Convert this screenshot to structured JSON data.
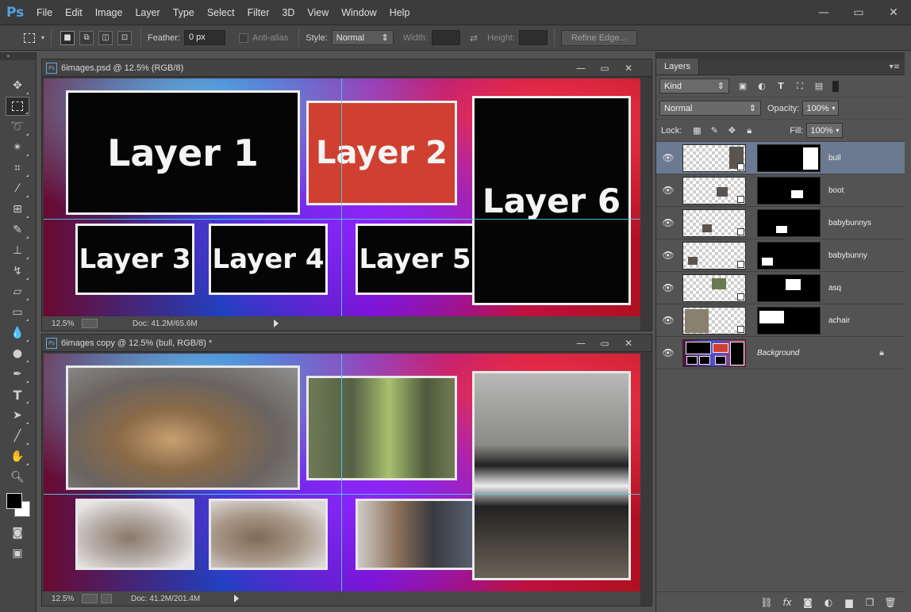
{
  "app": {
    "logo": "Ps",
    "menu": [
      "File",
      "Edit",
      "Image",
      "Layer",
      "Type",
      "Select",
      "Filter",
      "3D",
      "View",
      "Window",
      "Help"
    ]
  },
  "options": {
    "feather_label": "Feather:",
    "feather_value": "0 px",
    "antialias_label": "Anti-alias",
    "style_label": "Style:",
    "style_value": "Normal",
    "width_label": "Width:",
    "height_label": "Height:",
    "refine_label": "Refine Edge..."
  },
  "documents": [
    {
      "title": "6images.psd @ 12.5% (RGB/8)",
      "zoom": "12.5%",
      "doc_info": "Doc: 41.2M/65.6M",
      "frames": [
        "Layer 1",
        "Layer 2",
        "Layer 3",
        "Layer 4",
        "Layer 5",
        "Layer 6"
      ]
    },
    {
      "title": "6images copy @ 12.5% (bull, RGB/8) *",
      "zoom": "12.5%",
      "doc_info": "Doc: 41.2M/201.4M"
    }
  ],
  "layers_panel": {
    "tab": "Layers",
    "filter_kind": "Kind",
    "blend_mode": "Normal",
    "opacity_label": "Opacity:",
    "opacity_value": "100%",
    "lock_label": "Lock:",
    "fill_label": "Fill:",
    "fill_value": "100%",
    "layers": [
      {
        "name": "bull",
        "selected": true
      },
      {
        "name": "boot",
        "selected": false
      },
      {
        "name": "babybunnys",
        "selected": false
      },
      {
        "name": "babybunny",
        "selected": false
      },
      {
        "name": "asq",
        "selected": false
      },
      {
        "name": "achair",
        "selected": false
      },
      {
        "name": "Background",
        "selected": false
      }
    ]
  },
  "colors": {
    "accent": "#4fa3e6",
    "selected_layer": "#6b7a91",
    "guide": "#48d0e8",
    "frame_red": "#d04030"
  }
}
